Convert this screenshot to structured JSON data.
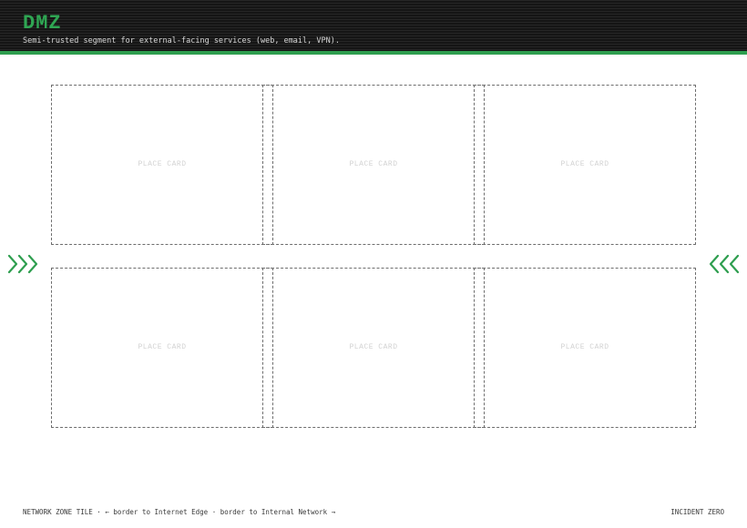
{
  "header": {
    "title": "DMZ",
    "subtitle": "Semi-trusted segment for external-facing services (web, email, VPN)."
  },
  "slots": [
    {
      "label": "PLACE CARD"
    },
    {
      "label": "PLACE CARD"
    },
    {
      "label": "PLACE CARD"
    },
    {
      "label": "PLACE CARD"
    },
    {
      "label": "PLACE CARD"
    },
    {
      "label": "PLACE CARD"
    }
  ],
  "edges": {
    "left_icon": "triple-chevron-right-icon",
    "right_icon": "triple-chevron-left-icon"
  },
  "footer": {
    "left": "NETWORK ZONE TILE · ← border to Internet Edge · border to Internal Network →",
    "right": "INCIDENT ZERO"
  },
  "colors": {
    "accent": "#2e9e4f",
    "header_bg": "#1b1b1b",
    "slot_border": "#6e6e6e"
  }
}
